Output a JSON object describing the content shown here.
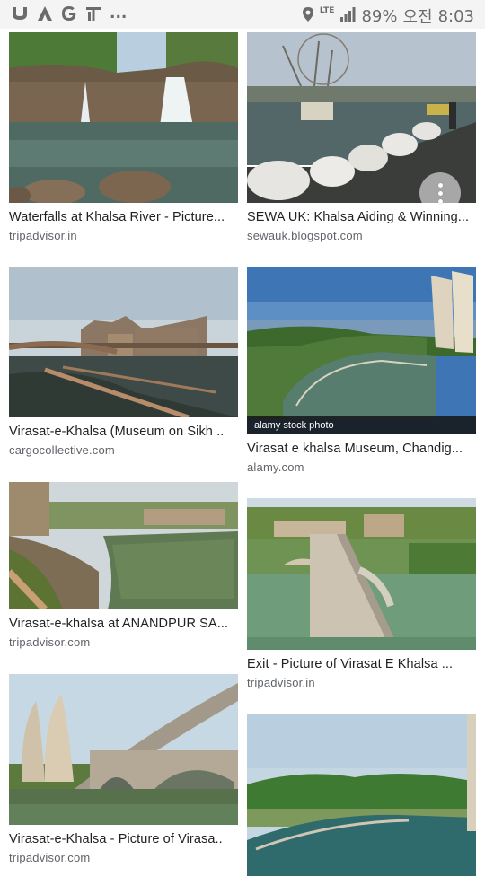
{
  "status_bar": {
    "left_icons": [
      "app-icon-u",
      "app-icon-a",
      "google-icon",
      "tv-icon"
    ],
    "more": "...",
    "network": "LTE",
    "battery": "89%",
    "ampm": "오전",
    "time": "8:03"
  },
  "results": [
    {
      "column": "left",
      "caption": "Waterfalls at Khalsa River - Picture...",
      "domain": "tripadvisor.in"
    },
    {
      "column": "right",
      "caption": "SEWA UK: Khalsa Aiding & Winning...",
      "domain": "sewauk.blogspot.com"
    },
    {
      "column": "left",
      "caption": "Virasat-e-Khalsa (Museum on Sikh ..",
      "domain": "cargocollective.com"
    },
    {
      "column": "right",
      "caption": "Virasat e khalsa Museum, Chandig...",
      "domain": "alamy.com",
      "overlay": "alamy stock photo"
    },
    {
      "column": "left",
      "caption": "Virasat-e-khalsa at ANANDPUR SA...",
      "domain": "tripadvisor.com"
    },
    {
      "column": "right",
      "caption": "Exit - Picture of Virasat E Khalsa ...",
      "domain": "tripadvisor.in"
    },
    {
      "column": "left",
      "caption": "Virasat-e-Khalsa - Picture of Virasa..",
      "domain": "tripadvisor.com"
    },
    {
      "column": "right",
      "caption": "",
      "domain": ""
    }
  ],
  "colors": {
    "caption": "#202124",
    "domain": "#5f6368",
    "statusbar": "#f4f4f4"
  }
}
